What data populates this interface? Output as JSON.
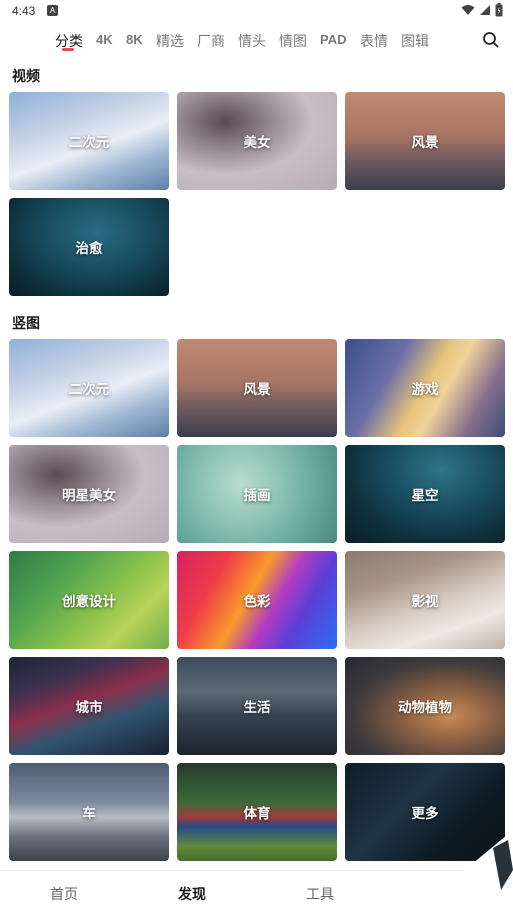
{
  "status_bar": {
    "time": "4:43",
    "notification": "A"
  },
  "tabs": [
    {
      "label": "分类",
      "active": true
    },
    {
      "label": "4K"
    },
    {
      "label": "8K"
    },
    {
      "label": "精选"
    },
    {
      "label": "厂商"
    },
    {
      "label": "情头"
    },
    {
      "label": "情图"
    },
    {
      "label": "PAD"
    },
    {
      "label": "表情"
    },
    {
      "label": "图辑"
    }
  ],
  "search_icon": "search-icon",
  "sections": [
    {
      "title": "视频",
      "items": [
        "二次元",
        "美女",
        "风景",
        "治愈"
      ]
    },
    {
      "title": "竖图",
      "items": [
        "二次元",
        "风景",
        "游戏",
        "明星美女",
        "插画",
        "星空",
        "创意设计",
        "色彩",
        "影视",
        "城市",
        "生活",
        "动物植物",
        "车",
        "体育",
        "更多"
      ]
    }
  ],
  "bottom_nav": [
    {
      "label": "首页"
    },
    {
      "label": "发现",
      "active": true
    },
    {
      "label": "工具"
    }
  ],
  "colors": {
    "accent": "#e8465a"
  }
}
